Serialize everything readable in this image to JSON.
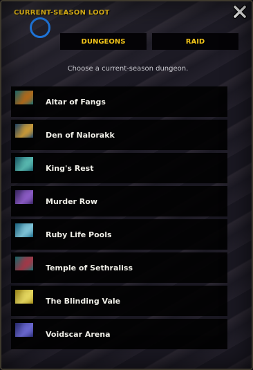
{
  "window": {
    "title": "CURRENT-SEASON LOOT",
    "close_icon": "close-x-icon"
  },
  "tabs": [
    {
      "label": "DUNGEONS"
    },
    {
      "label": "RAID"
    }
  ],
  "subtitle": "Choose a current-season dungeon.",
  "dungeons": [
    {
      "name": "Altar of Fangs",
      "icon": "altar-of-fangs-thumbnail",
      "colors": [
        "#1f6f72",
        "#b06a1c"
      ]
    },
    {
      "name": "Den of Nalorakk",
      "icon": "den-of-nalorakk-thumbnail",
      "colors": [
        "#234a6e",
        "#c99a3a"
      ]
    },
    {
      "name": "King's Rest",
      "icon": "kings-rest-thumbnail",
      "colors": [
        "#1c5f6c",
        "#58b8b0"
      ]
    },
    {
      "name": "Murder Row",
      "icon": "murder-row-thumbnail",
      "colors": [
        "#3b2766",
        "#8c5cc6"
      ]
    },
    {
      "name": "Ruby Life Pools",
      "icon": "ruby-life-pools-thumbnail",
      "colors": [
        "#1f6d8c",
        "#7fc4d8"
      ]
    },
    {
      "name": "Temple of Sethraliss",
      "icon": "temple-of-sethraliss-thumbnail",
      "colors": [
        "#1c7274",
        "#a23a4a"
      ]
    },
    {
      "name": "The Blinding Vale",
      "icon": "the-blinding-vale-thumbnail",
      "colors": [
        "#a58f1c",
        "#e6d860"
      ]
    },
    {
      "name": "Voidscar Arena",
      "icon": "voidscar-arena-thumbnail",
      "colors": [
        "#2c2f78",
        "#6a68d0"
      ]
    }
  ]
}
